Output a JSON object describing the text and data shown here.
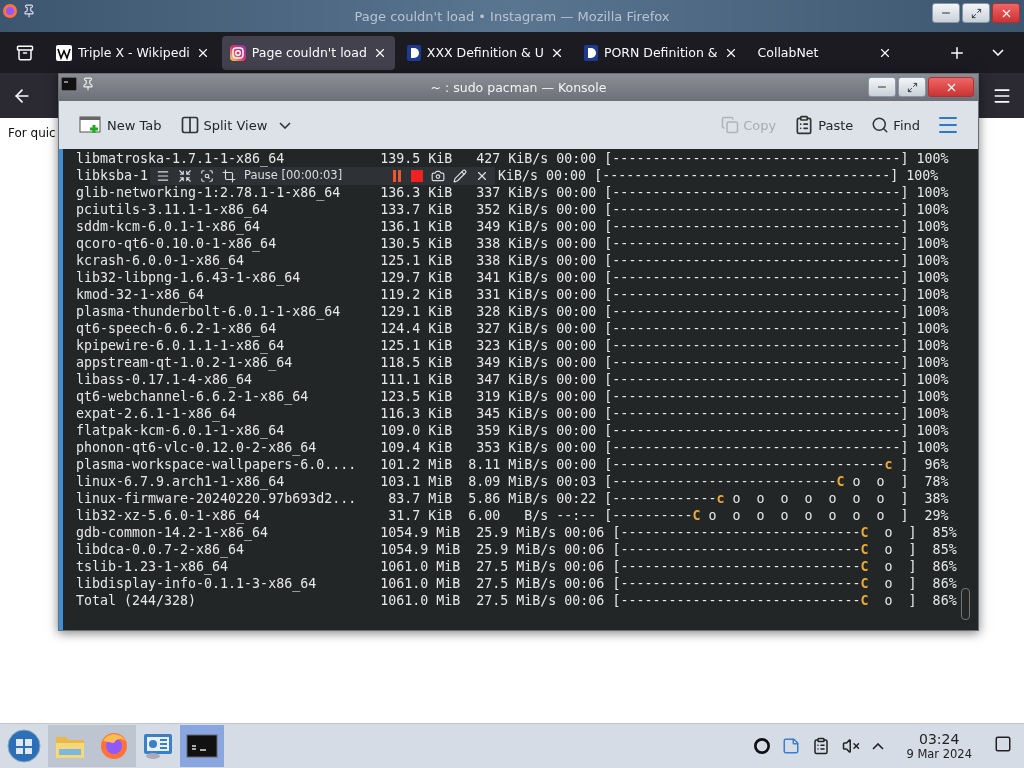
{
  "browser": {
    "title": "Page couldn't load • Instagram — Mozilla Firefox",
    "tabs": [
      {
        "title": "Triple X - Wikipedi",
        "kind": "wiki",
        "selected": false
      },
      {
        "title": "Page couldn't load",
        "kind": "insta",
        "selected": true
      },
      {
        "title": "XXX Definition & U",
        "kind": "dict",
        "selected": false
      },
      {
        "title": "PORN Definition &",
        "kind": "dict",
        "selected": false
      },
      {
        "title": "CollabNet",
        "kind": "plain",
        "selected": false
      }
    ],
    "page_text": "For quic"
  },
  "konsole": {
    "title": "~ : sudo pacman — Konsole",
    "toolbar": [
      {
        "label": "New Tab",
        "kind": "newtab",
        "disabled": false
      },
      {
        "label": "Split View",
        "kind": "split",
        "disabled": false
      },
      {
        "label": "Copy",
        "kind": "copy",
        "disabled": true
      },
      {
        "label": "Paste",
        "kind": "paste",
        "disabled": false
      },
      {
        "label": "Find",
        "kind": "find",
        "disabled": false
      }
    ],
    "recorder": {
      "status": "Pause [00:00:03]"
    },
    "lines": [
      {
        "name": "libmatroska-1.7.1-1-x86_64",
        "size": "139.5 KiB",
        "rate": "427 KiB/s",
        "eta": "00:00",
        "fill": "[------------------------------------]",
        "percent": "100%"
      },
      {
        "name": "libksba-1",
        "kind": "covered",
        "rate": "KiB/s",
        "eta": "00:00",
        "fill": "[------------------------------------]",
        "percent": "100%"
      },
      {
        "name": "glib-networking-1:2.78.1-1-x86_64",
        "size": "136.3 KiB",
        "rate": "337 KiB/s",
        "eta": "00:00",
        "fill": "[------------------------------------]",
        "percent": "100%"
      },
      {
        "name": "pciutils-3.11.1-1-x86_64",
        "size": "133.7 KiB",
        "rate": "352 KiB/s",
        "eta": "00:00",
        "fill": "[------------------------------------]",
        "percent": "100%"
      },
      {
        "name": "sddm-kcm-6.0.1-1-x86_64",
        "size": "136.1 KiB",
        "rate": "349 KiB/s",
        "eta": "00:00",
        "fill": "[------------------------------------]",
        "percent": "100%"
      },
      {
        "name": "qcoro-qt6-0.10.0-1-x86_64",
        "size": "130.5 KiB",
        "rate": "338 KiB/s",
        "eta": "00:00",
        "fill": "[------------------------------------]",
        "percent": "100%"
      },
      {
        "name": "kcrash-6.0.0-1-x86_64",
        "size": "125.1 KiB",
        "rate": "338 KiB/s",
        "eta": "00:00",
        "fill": "[------------------------------------]",
        "percent": "100%"
      },
      {
        "name": "lib32-libpng-1.6.43-1-x86_64",
        "size": "129.7 KiB",
        "rate": "341 KiB/s",
        "eta": "00:00",
        "fill": "[------------------------------------]",
        "percent": "100%"
      },
      {
        "name": "kmod-32-1-x86_64",
        "size": "119.2 KiB",
        "rate": "331 KiB/s",
        "eta": "00:00",
        "fill": "[------------------------------------]",
        "percent": "100%"
      },
      {
        "name": "plasma-thunderbolt-6.0.1-1-x86_64",
        "size": "129.1 KiB",
        "rate": "328 KiB/s",
        "eta": "00:00",
        "fill": "[------------------------------------]",
        "percent": "100%"
      },
      {
        "name": "qt6-speech-6.6.2-1-x86_64",
        "size": "124.4 KiB",
        "rate": "327 KiB/s",
        "eta": "00:00",
        "fill": "[------------------------------------]",
        "percent": "100%"
      },
      {
        "name": "kpipewire-6.0.1.1-1-x86_64",
        "size": "125.1 KiB",
        "rate": "323 KiB/s",
        "eta": "00:00",
        "fill": "[------------------------------------]",
        "percent": "100%"
      },
      {
        "name": "appstream-qt-1.0.2-1-x86_64",
        "size": "118.5 KiB",
        "rate": "349 KiB/s",
        "eta": "00:00",
        "fill": "[------------------------------------]",
        "percent": "100%"
      },
      {
        "name": "libass-0.17.1-4-x86_64",
        "size": "111.1 KiB",
        "rate": "347 KiB/s",
        "eta": "00:00",
        "fill": "[------------------------------------]",
        "percent": "100%"
      },
      {
        "name": "qt6-webchannel-6.6.2-1-x86_64",
        "size": "123.5 KiB",
        "rate": "319 KiB/s",
        "eta": "00:00",
        "fill": "[------------------------------------]",
        "percent": "100%"
      },
      {
        "name": "expat-2.6.1-1-x86_64",
        "size": "116.3 KiB",
        "rate": "345 KiB/s",
        "eta": "00:00",
        "fill": "[------------------------------------]",
        "percent": "100%"
      },
      {
        "name": "flatpak-kcm-6.0.1-1-x86_64",
        "size": "109.0 KiB",
        "rate": "359 KiB/s",
        "eta": "00:00",
        "fill": "[------------------------------------]",
        "percent": "100%"
      },
      {
        "name": "phonon-qt6-vlc-0.12.0-2-x86_64",
        "size": "109.4 KiB",
        "rate": "353 KiB/s",
        "eta": "00:00",
        "fill": "[------------------------------------]",
        "percent": "100%"
      },
      {
        "name": "plasma-workspace-wallpapers-6.0....",
        "size": "101.2 MiB",
        "rate": "8.11 MiB/s",
        "eta": "00:00",
        "fill": "[----------------------------------",
        "head": "c",
        "rest": " ]",
        "percent": "96%"
      },
      {
        "name": "linux-6.7.9.arch1-1-x86_64",
        "size": "103.1 MiB",
        "rate": "8.09 MiB/s",
        "eta": "00:03",
        "fill": "[----------------------------",
        "head": "C",
        "rest": " o  o  ]",
        "percent": "78%"
      },
      {
        "name": "linux-firmware-20240220.97b693d2...",
        "size": "83.7 MiB",
        "rate": "5.86 MiB/s",
        "eta": "00:22",
        "fill": "[-------------",
        "head": "c",
        "rest": " o  o  o  o  o  o  o  ]",
        "percent": "38%"
      },
      {
        "name": "lib32-xz-5.6.0-1-x86_64",
        "size": "31.7 KiB",
        "rate": "6.00   B/s",
        "eta": "--:--",
        "fill": "[----------",
        "head": "C",
        "rest": " o  o  o  o  o  o  o  o  ]",
        "percent": "29%"
      },
      {
        "name": "gdb-common-14.2-1-x86_64",
        "size": "1054.9 MiB",
        "rate": "25.9 MiB/s",
        "eta": "00:06",
        "fill": "[------------------------------",
        "head": "C",
        "rest": "  o  ]",
        "percent": "85%"
      },
      {
        "name": "libdca-0.0.7-2-x86_64",
        "size": "1054.9 MiB",
        "rate": "25.9 MiB/s",
        "eta": "00:06",
        "fill": "[------------------------------",
        "head": "C",
        "rest": "  o  ]",
        "percent": "85%"
      },
      {
        "name": "tslib-1.23-1-x86_64",
        "size": "1061.0 MiB",
        "rate": "27.5 MiB/s",
        "eta": "00:06",
        "fill": "[------------------------------",
        "head": "C",
        "rest": "  o  ]",
        "percent": "86%"
      },
      {
        "name": "libdisplay-info-0.1.1-3-x86_64",
        "size": "1061.0 MiB",
        "rate": "27.5 MiB/s",
        "eta": "00:06",
        "fill": "[------------------------------",
        "head": "C",
        "rest": "  o  ]",
        "percent": "86%"
      },
      {
        "name": "Total (244/328)",
        "size": "1061.0 MiB",
        "rate": "27.5 MiB/s",
        "eta": "00:06",
        "fill": "[------------------------------",
        "head": "C",
        "rest": "  o  ]",
        "percent": "86%"
      }
    ]
  },
  "taskbar": {
    "apps": [
      {
        "kind": "files",
        "open": true,
        "selected": false
      },
      {
        "kind": "firefox",
        "open": true,
        "selected": false
      },
      {
        "kind": "monitor",
        "open": false,
        "selected": false
      },
      {
        "kind": "terminal",
        "open": true,
        "selected": true
      }
    ],
    "clock": {
      "time": "03:24",
      "date": "9 Mar 2024"
    }
  }
}
